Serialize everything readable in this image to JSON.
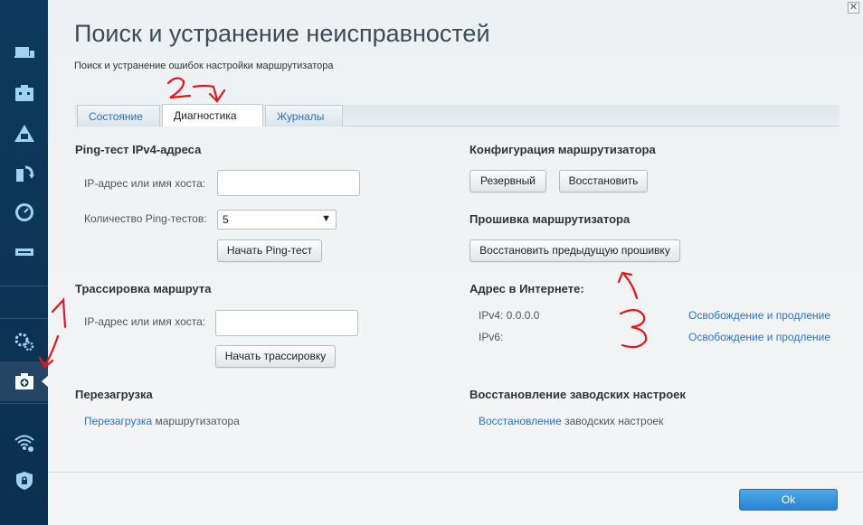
{
  "header": {
    "title": "Поиск и устранение неисправностей",
    "subtitle": "Поиск и устранение ошибок настройки маршрутизатора",
    "close_label": "✕"
  },
  "sidebar": {
    "items": [
      {
        "icon": "devices-icon"
      },
      {
        "icon": "toolbox-icon"
      },
      {
        "icon": "network-map-icon"
      },
      {
        "icon": "update-icon"
      },
      {
        "icon": "clock-icon"
      },
      {
        "icon": "usb-icon"
      },
      {
        "icon": "settings-icon"
      },
      {
        "icon": "troubleshooting-icon",
        "active": true
      },
      {
        "icon": "wifi-settings-icon"
      },
      {
        "icon": "security-icon"
      }
    ]
  },
  "tabs": [
    {
      "label": "Состояние"
    },
    {
      "label": "Диагностика",
      "active": true
    },
    {
      "label": "Журналы"
    }
  ],
  "ping": {
    "heading": "Ping-тест IPv4-адреса",
    "host_label": "IP-адрес или имя хоста:",
    "host_value": "",
    "count_label": "Количество Ping-тестов:",
    "count_value": "5",
    "start_button": "Начать Ping-тест"
  },
  "trace": {
    "heading": "Трассировка маршрута",
    "host_label": "IP-адрес или имя хоста:",
    "host_value": "",
    "start_button": "Начать трассировку"
  },
  "reboot": {
    "heading": "Перезагрузка",
    "link": "Перезагрузка",
    "text": " маршрутизатора"
  },
  "config": {
    "heading": "Конфигурация маршрутизатора",
    "backup_button": "Резервный",
    "restore_button": "Восстановить"
  },
  "firmware": {
    "heading": "Прошивка маршрутизатора",
    "restore_prev_button": "Восстановить предыдущую прошивку"
  },
  "internet": {
    "heading": "Адрес в Интернете:",
    "ipv4_label": "IPv4: 0.0.0.0",
    "ipv6_label": "IPv6:",
    "ipv4_link": "Освобождение и продление",
    "ipv6_link": "Освобождение и продление"
  },
  "factory": {
    "heading": "Восстановление заводских настроек",
    "link": "Восстановление",
    "text": " заводских настроек"
  },
  "footer": {
    "ok_button": "Ok"
  },
  "annotations": {
    "mark1": "1",
    "mark2": "2",
    "mark3": "3",
    "color": "#e8141b"
  },
  "colors": {
    "sidebar_bg": "#0d3a5e",
    "link": "#2b74c5",
    "ok_button": "#2a84cf"
  }
}
